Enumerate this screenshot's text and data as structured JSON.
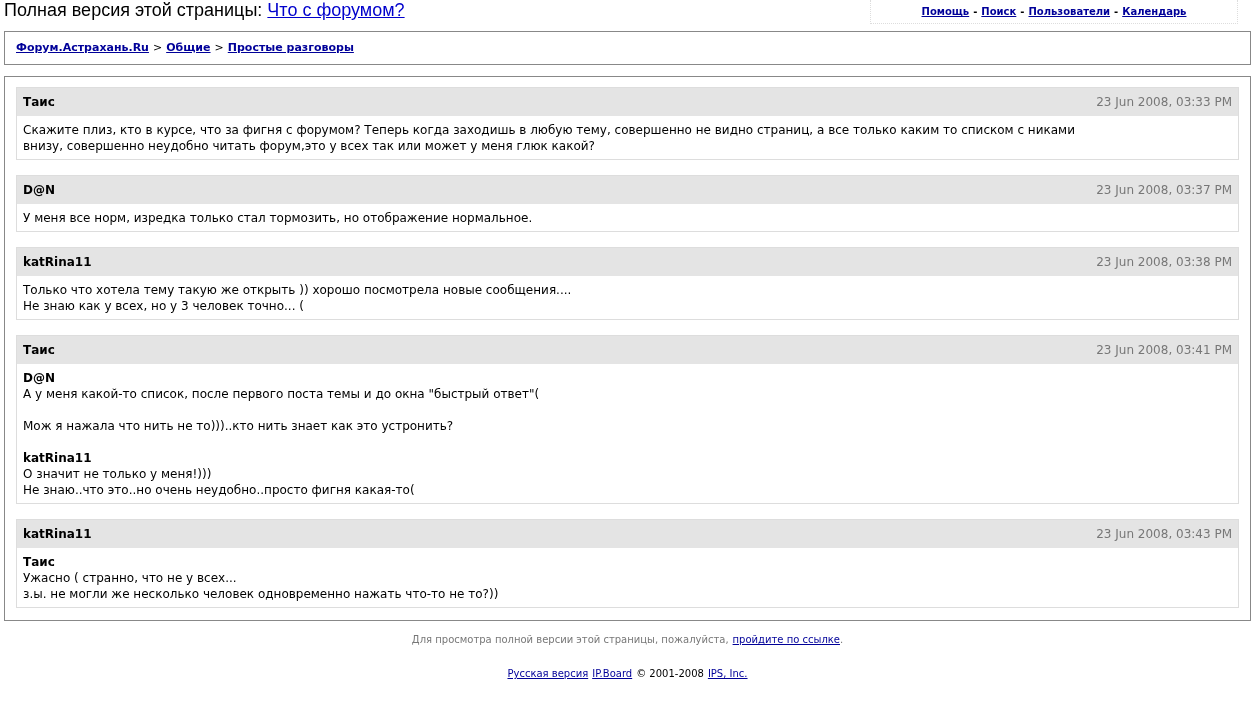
{
  "header": {
    "title_prefix": "Полная версия этой страницы:",
    "title_link": "Что с форумом?"
  },
  "nav_links": [
    {
      "kind": "link",
      "text": "Помощь"
    },
    {
      "kind": "separator",
      "text": "-"
    },
    {
      "kind": "link",
      "text": "Поиск"
    },
    {
      "kind": "separator",
      "text": "-"
    },
    {
      "kind": "link",
      "text": "Пользователи"
    },
    {
      "kind": "separator",
      "text": "-"
    },
    {
      "kind": "link",
      "text": "Календарь"
    }
  ],
  "breadcrumb": [
    {
      "kind": "link",
      "text": "Форум.Астрахань.Ru"
    },
    {
      "kind": "separator",
      "text": ">"
    },
    {
      "kind": "link",
      "text": "Общие"
    },
    {
      "kind": "separator",
      "text": ">"
    },
    {
      "kind": "link",
      "text": "Простые разговоры"
    }
  ],
  "posts": [
    {
      "author": "Таис",
      "date": "23 Jun 2008, 03:33 PM",
      "blocks": [
        {
          "lines": [
            "Скажите плиз, кто в курсе, что за фигня с форумом? Теперь когда заходишь в любую тему, совершенно не видно страниц, а все только каким то списком с никами",
            "внизу, совершенно неудобно читать форум,это у всех так или может у меня глюк какой?"
          ]
        }
      ]
    },
    {
      "author": "D@N",
      "date": "23 Jun 2008, 03:37 PM",
      "blocks": [
        {
          "lines": [
            "У меня все норм, изредка только стал тормозить, но отображение нормальное."
          ]
        }
      ]
    },
    {
      "author": "katRina11",
      "date": "23 Jun 2008, 03:38 PM",
      "blocks": [
        {
          "lines": [
            "Только что хотела тему такую же открыть )) хорошо посмотрела новые сообщения....",
            "Не знаю как у всех, но у 3 человек точно... ("
          ]
        }
      ]
    },
    {
      "author": "Таис",
      "date": "23 Jun 2008, 03:41 PM",
      "blocks": [
        {
          "quoted": "D@N",
          "lines": [
            "А у меня какой-то список, после первого поста темы и до окна \"быстрый ответ\"("
          ]
        },
        {
          "lines": [
            "Мож я нажала что нить не то)))..кто нить знает как это устронить?"
          ]
        },
        {
          "quoted": "katRina11",
          "lines": [
            "О значит не только у меня!)))",
            "Не знаю..что это..но очень неудобно..просто фигня какая-то("
          ]
        }
      ]
    },
    {
      "author": "katRina11",
      "date": "23 Jun 2008, 03:43 PM",
      "blocks": [
        {
          "quoted": "Таис",
          "lines": [
            "Ужасно ( странно, что не у всех...",
            "з.ы. не могли же несколько человек одновременно нажать что-то не то?))"
          ]
        }
      ]
    }
  ],
  "footer": {
    "notice": "Для просмотра полной версии этой страницы, пожалуйста,",
    "notice_link": "пройдите по ссылке",
    "notice_end": ".",
    "credits": [
      {
        "kind": "link",
        "text": "Русская версия"
      },
      {
        "kind": "link",
        "text": "IP.Board"
      },
      {
        "kind": "text",
        "text": "© 2001-2008"
      },
      {
        "kind": "link",
        "text": "IPS, Inc."
      }
    ]
  }
}
